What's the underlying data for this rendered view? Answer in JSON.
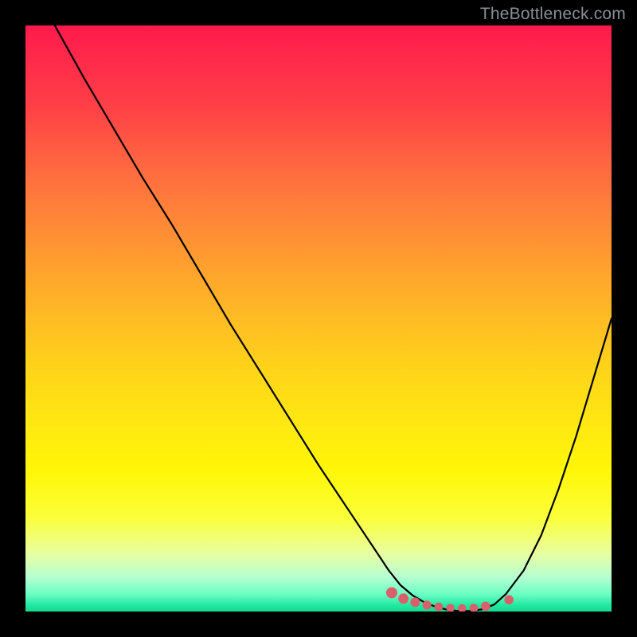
{
  "watermark": {
    "text": "TheBottleneck.com"
  },
  "chart_data": {
    "type": "line",
    "title": "",
    "xlabel": "",
    "ylabel": "",
    "xlim": [
      0,
      100
    ],
    "ylim": [
      0,
      100
    ],
    "grid": false,
    "legend": false,
    "series": [
      {
        "name": "bottleneck-curve",
        "x": [
          5,
          10,
          15,
          20,
          25,
          30,
          35,
          40,
          45,
          50,
          55,
          60,
          62,
          64,
          66,
          68,
          70,
          72,
          74,
          76,
          78,
          80,
          82,
          85,
          88,
          91,
          94,
          97,
          100
        ],
        "y": [
          100,
          91,
          82.5,
          74,
          66,
          57.5,
          49,
          41,
          33,
          25,
          17.5,
          10,
          7,
          4.5,
          2.8,
          1.6,
          0.8,
          0.3,
          0.1,
          0.1,
          0.4,
          1.2,
          3,
          7,
          13,
          21,
          30,
          40,
          50
        ]
      }
    ],
    "markers": {
      "name": "optimal-range",
      "x": [
        62.5,
        64.5,
        66.5,
        68.5,
        70.5,
        72.5,
        74.5,
        76.5,
        78.5,
        82.5
      ],
      "y": [
        3.2,
        2.2,
        1.6,
        1.1,
        0.8,
        0.6,
        0.55,
        0.6,
        0.9,
        2.0
      ],
      "radius": [
        7,
        6.5,
        6,
        5.6,
        5.4,
        5.2,
        5.2,
        5.4,
        5.8,
        5.8
      ],
      "color": "#d9606a"
    },
    "background_gradient": {
      "top": "#ff1a4d",
      "mid": "#ffe812",
      "bottom": "#16d88e"
    }
  }
}
